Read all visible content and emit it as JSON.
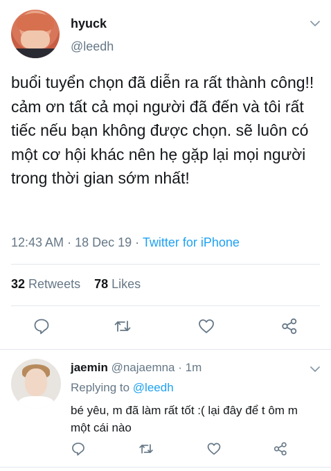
{
  "tweet": {
    "author_name": "hyuck",
    "author_handle": "@leedh",
    "text": "buổi tuyển chọn đã diễn ra rất thành công!! cảm ơn tất cả mọi người đã đến và tôi rất tiếc nếu bạn không được chọn. sẽ luôn có một cơ hội khác nên hẹ gặp lại mọi người trong thời gian sớm nhất!",
    "time": "12:43 AM",
    "date": "18 Dec 19",
    "separator": "·",
    "source": "Twitter for iPhone",
    "retweets_count": "32",
    "retweets_label": "Retweets",
    "likes_count": "78",
    "likes_label": "Likes"
  },
  "reply": {
    "author_name": "jaemin",
    "author_handle": "@najaemna",
    "separator": "·",
    "age": "1m",
    "replying_label": "Replying to",
    "replying_to": "@leedh",
    "text": "bé yêu, m đã làm rất tốt :( lại đây để t ôm m một cái nào"
  },
  "icons": {
    "reply": "reply-icon",
    "retweet": "retweet-icon",
    "like": "heart-icon",
    "share": "share-icon",
    "menu": "chevron-down-icon"
  },
  "colors": {
    "accent": "#1da1f2",
    "muted": "#657786",
    "text": "#14171a",
    "divider": "#e1e8ed"
  }
}
